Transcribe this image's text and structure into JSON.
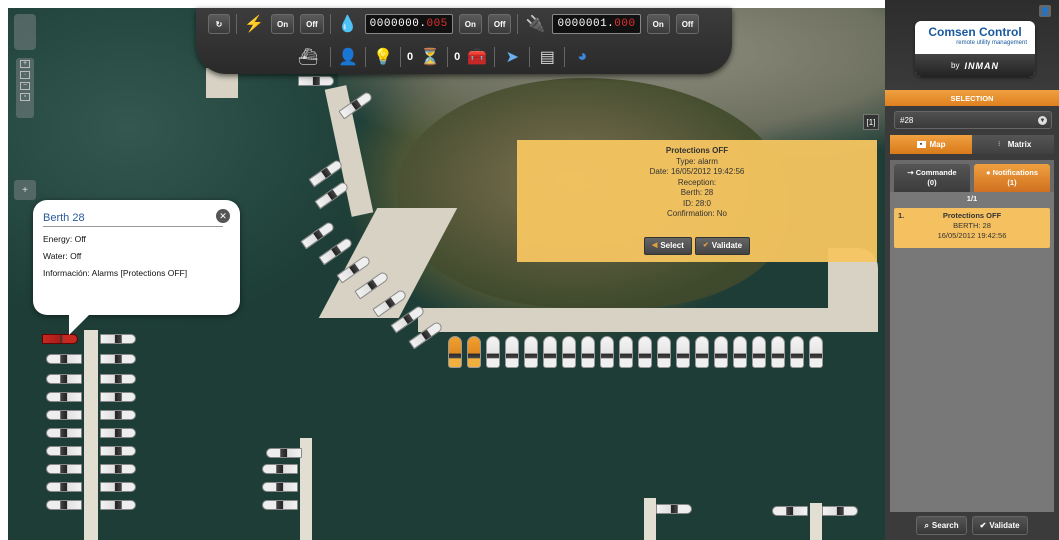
{
  "toolbar": {
    "btn_on_1": "On",
    "btn_off_1": "Off",
    "water_counter_main": "0000000.",
    "water_counter_dec": "005",
    "btn_on_2": "On",
    "btn_off_2": "Off",
    "energy_counter_main": "0000001.",
    "energy_counter_dec": "000",
    "btn_on_3": "On",
    "btn_off_3": "Off",
    "alarm_count": "0",
    "occupied_count": "0"
  },
  "map_overview_label": "[1]",
  "berth_popup": {
    "title": "Berth 28",
    "energy": "Energy: Off",
    "water": "Water: Off",
    "info": "Información: Alarms [Protections OFF]"
  },
  "alarm_popup": {
    "title": "Protections OFF",
    "type": "Type: alarm",
    "date": "Date: 16/05/2012 19:42:56",
    "reception": "Reception:",
    "berth": "Berth: 28",
    "id": "ID: 28:0",
    "confirmation": "Confirmation: No",
    "select_label": "Select",
    "validate_label": "Validate"
  },
  "panel": {
    "logo_main": "Comsen Control",
    "logo_sub": "remote utility management",
    "logo_by": "by",
    "logo_brand": "INMAN",
    "selection_title": "SELECTION",
    "selection_value": "#28",
    "tab_map": "Map",
    "tab_matrix": "Matrix",
    "tab_commands": "Commande",
    "tab_commands_count": "(0)",
    "tab_notifications": "Notifications",
    "tab_notifications_count": "(1)",
    "pager": "1/1",
    "notification": {
      "index": "1.",
      "title": "Protections OFF",
      "berth": "BERTH: 28",
      "date": "16/05/2012 19:42:56"
    },
    "search_label": "Search",
    "validate_label": "Validate"
  },
  "colors": {
    "accent_orange": "#f0a040",
    "alarm_yellow": "#f5c560",
    "counter_red": "#e03030"
  }
}
